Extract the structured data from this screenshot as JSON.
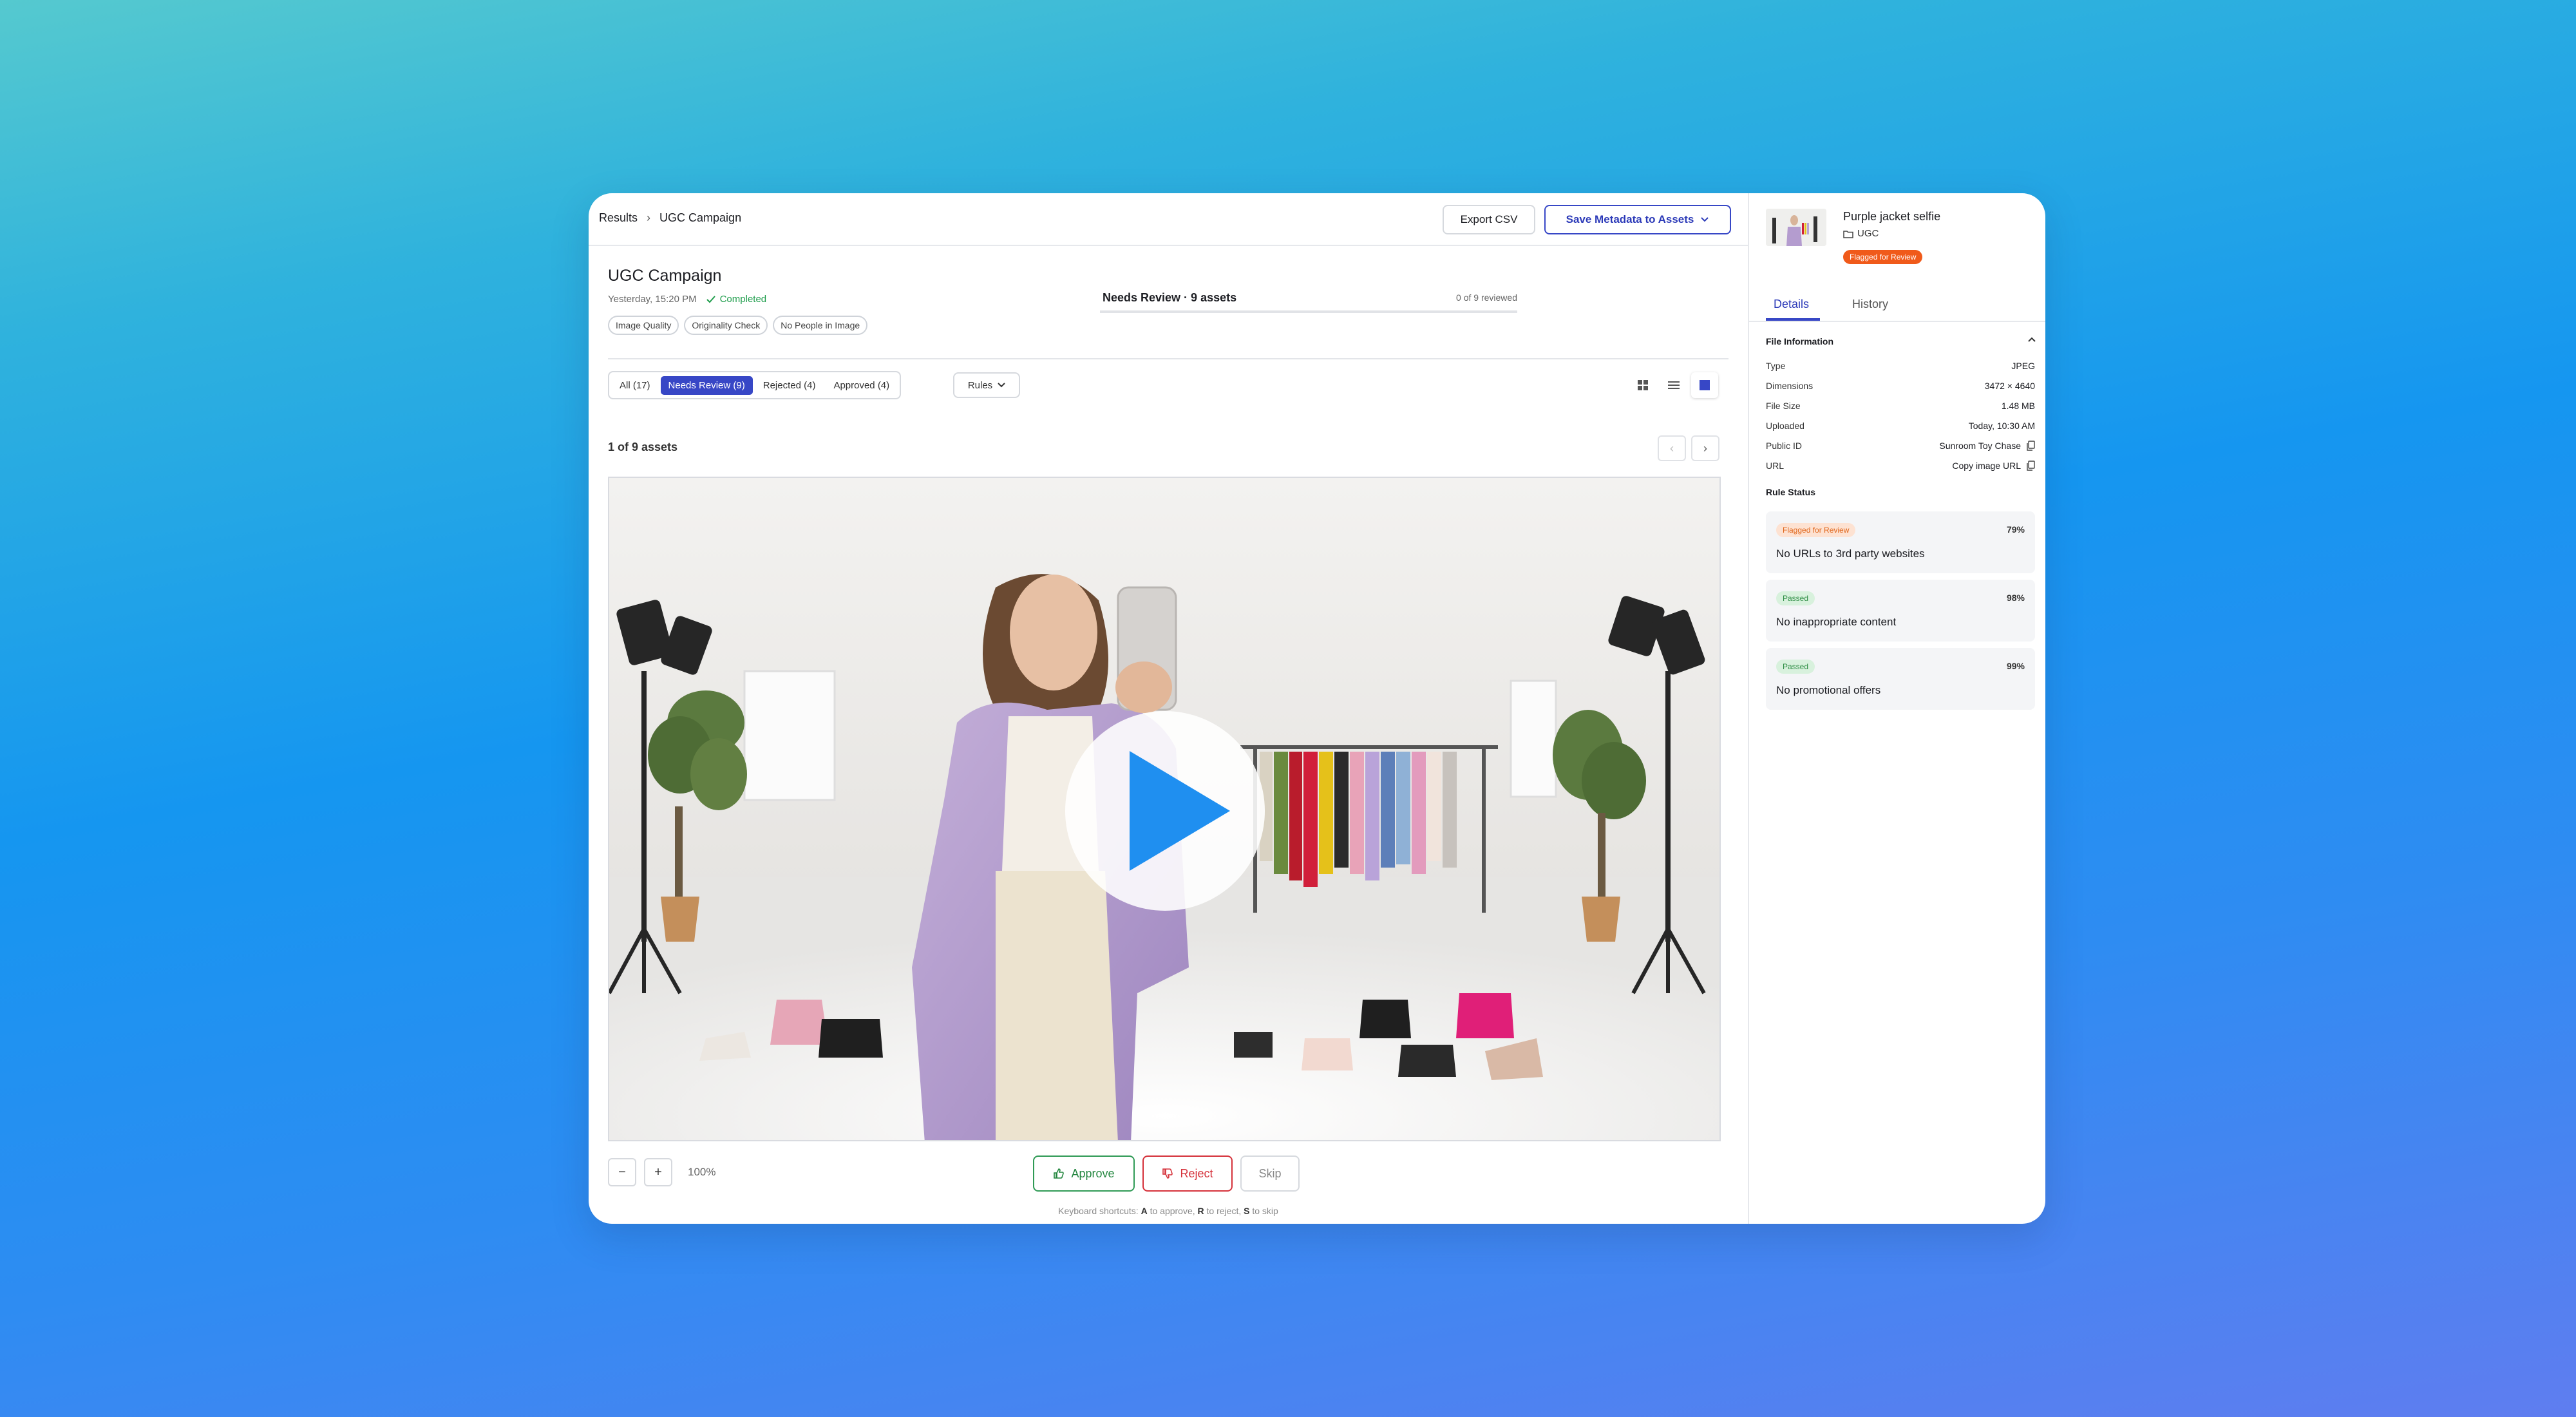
{
  "breadcrumb": {
    "root": "Results",
    "current": "UGC Campaign"
  },
  "toolbar": {
    "export_label": "Export CSV",
    "save_label": "Save Metadata to Assets"
  },
  "campaign": {
    "title": "UGC Campaign",
    "timestamp": "Yesterday, 15:20 PM",
    "status": "Completed",
    "rule_chips": [
      "Image Quality",
      "Originality Check",
      "No People in Image"
    ]
  },
  "review": {
    "heading": "Needs Review · 9 assets",
    "progress": "0 of 9 reviewed"
  },
  "filters": {
    "tabs": [
      {
        "label": "All (17)"
      },
      {
        "label": "Needs Review (9)"
      },
      {
        "label": "Rejected (4)"
      },
      {
        "label": "Approved (4)"
      }
    ],
    "active_tab": "Needs Review (9)",
    "rules_label": "Rules"
  },
  "view_modes": [
    "grid-icon",
    "list-icon",
    "single-icon"
  ],
  "asset_count": "1 of 9 assets",
  "zoom": {
    "minus": "−",
    "plus": "+",
    "value": "100%"
  },
  "actions": {
    "approve": "Approve",
    "reject": "Reject",
    "skip": "Skip"
  },
  "shortcuts": {
    "prefix": "Keyboard shortcuts: ",
    "a": "A",
    "a_text": " to approve, ",
    "r": "R",
    "r_text": " to reject, ",
    "s": "S",
    "s_text": " to skip"
  },
  "sidebar": {
    "asset_name": "Purple jacket selfie",
    "folder": "UGC",
    "flag": "Flagged for Review",
    "tabs": [
      "Details",
      "History"
    ],
    "file_info_title": "File Information",
    "file_info": [
      {
        "label": "Type",
        "value": "JPEG"
      },
      {
        "label": "Dimensions",
        "value": "3472 × 4640"
      },
      {
        "label": "File Size",
        "value": "1.48 MB"
      },
      {
        "label": "Uploaded",
        "value": "Today, 10:30 AM"
      },
      {
        "label": "Public ID",
        "value": "Sunroom Toy Chase"
      },
      {
        "label": "URL",
        "value": "Copy image URL"
      }
    ],
    "rule_status_title": "Rule Status",
    "rules": [
      {
        "badge": "Flagged for Review",
        "pct": "79%",
        "text": "No URLs to 3rd party websites"
      },
      {
        "badge": "Passed",
        "pct": "98%",
        "text": "No inappropriate content"
      },
      {
        "badge": "Passed",
        "pct": "99%",
        "text": "No promotional offers"
      }
    ]
  },
  "colors": {
    "accent": "#3747c6",
    "approve": "#2f9a55",
    "reject": "#d5313a",
    "flag": "#f05a1a",
    "play": "#1f8ff0"
  }
}
